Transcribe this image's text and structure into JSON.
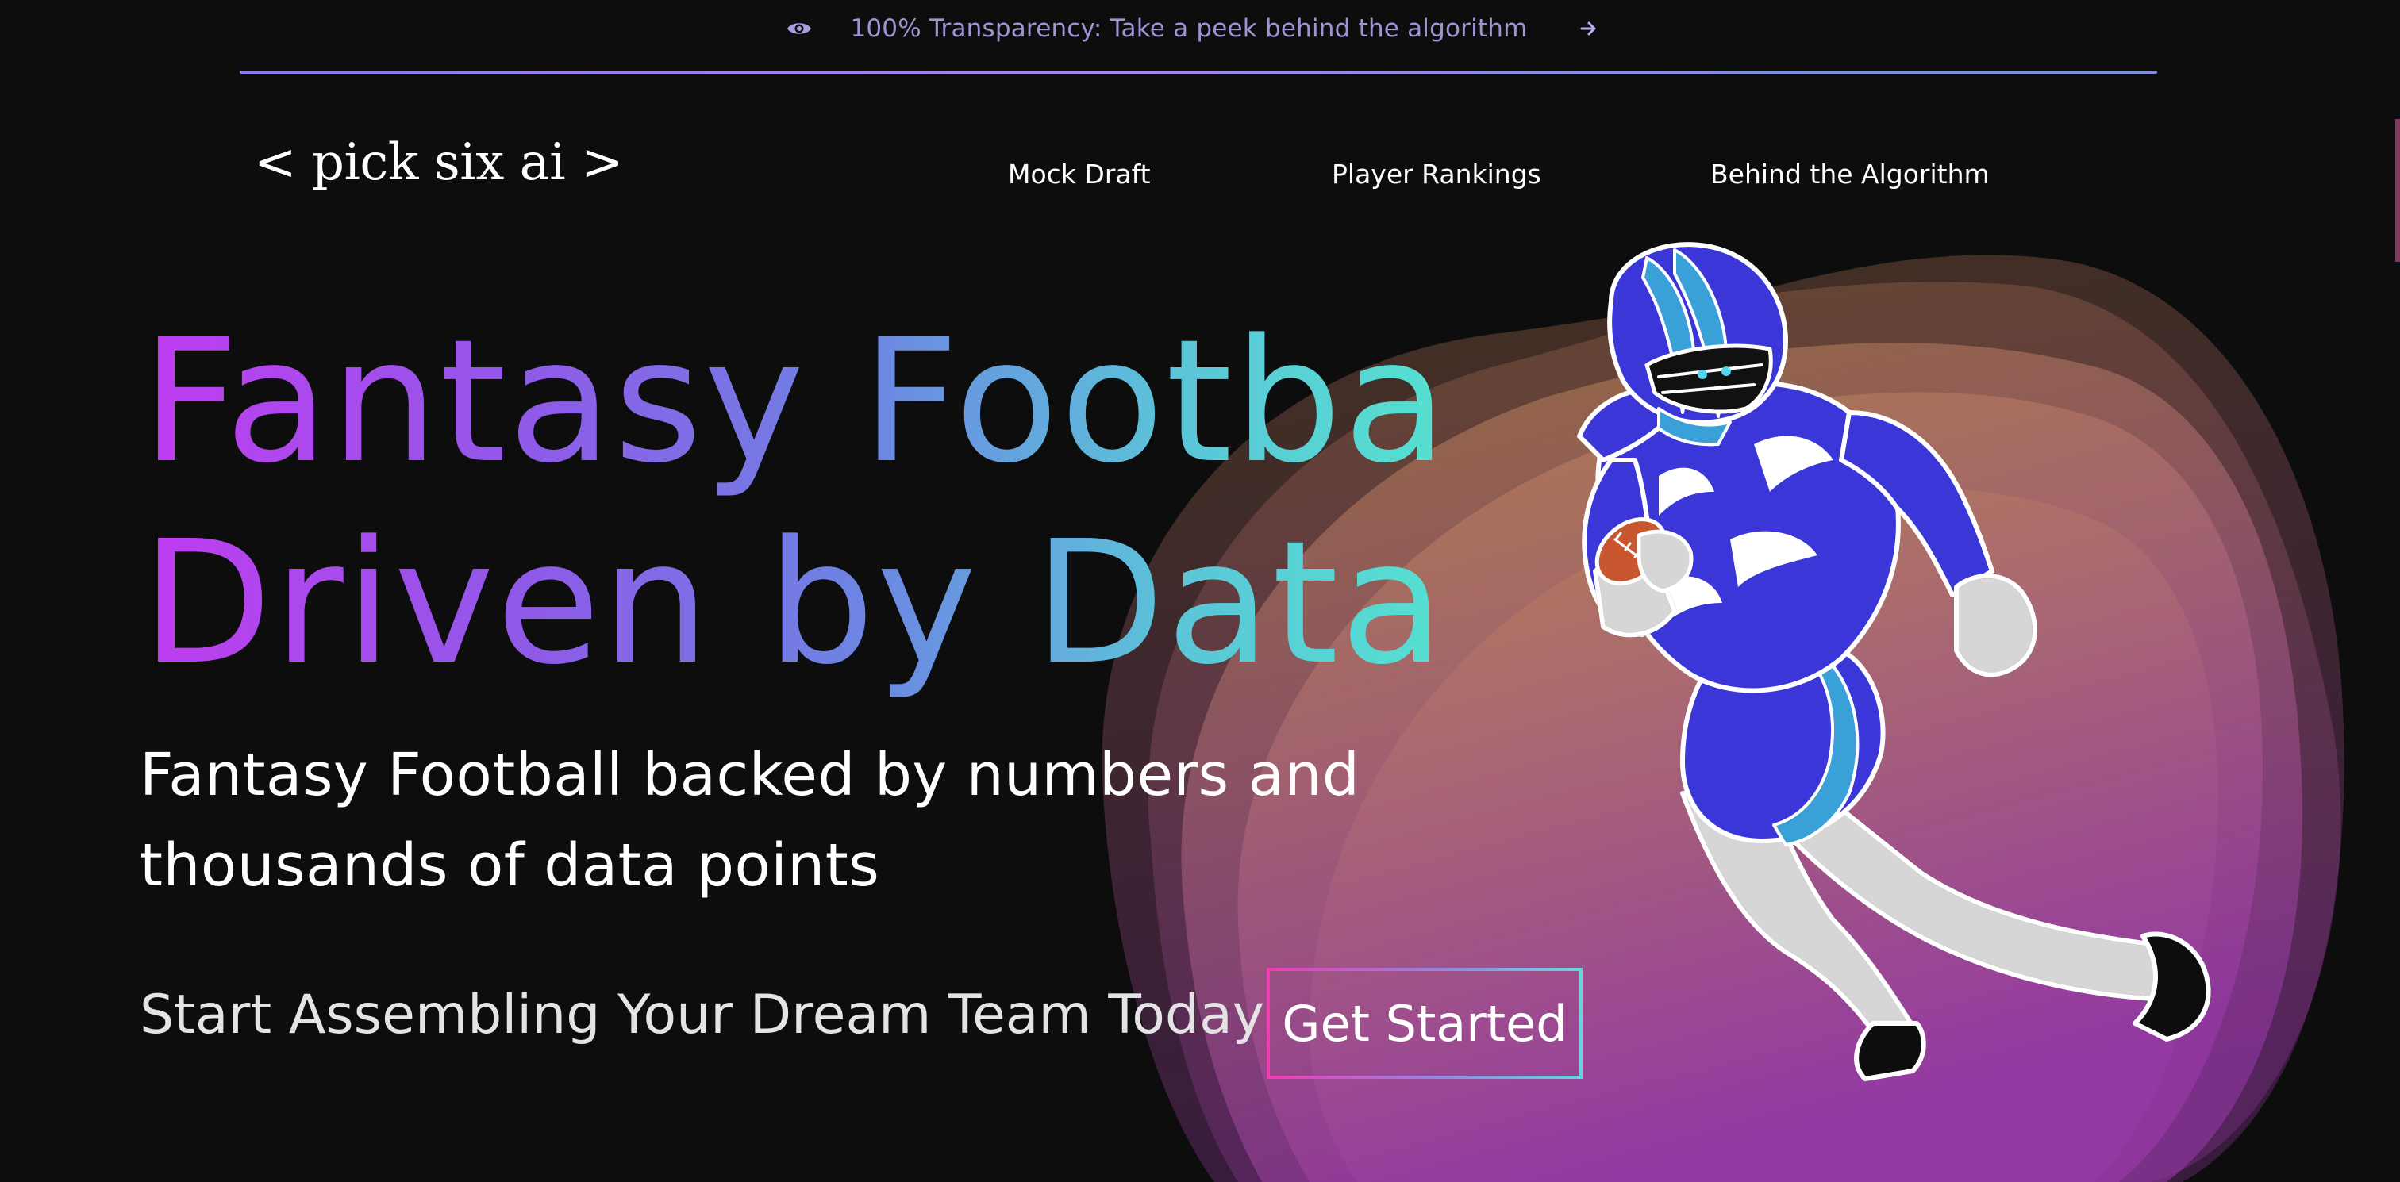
{
  "banner": {
    "icon": "eye-icon",
    "text": "100% Transparency: Take a peek behind the algorithm",
    "arrow_icon": "arrow-right-icon"
  },
  "brand": {
    "logo": "< pick six ai >"
  },
  "nav": {
    "items": [
      {
        "label": "Mock Draft"
      },
      {
        "label": "Player Rankings"
      },
      {
        "label": "Behind the Algorithm"
      }
    ]
  },
  "hero": {
    "headline_line1": "Fantasy Football",
    "headline_line2": "Driven by Data.",
    "sub_line1": "Fantasy Football backed by numbers and",
    "sub_line2": "thousands of data points",
    "cta_text": "Start Assembling Your Dream Team Today",
    "cta_button": "Get Started"
  },
  "colors": {
    "background": "#0d0d0e",
    "banner_text": "#9f93d6",
    "headline_gradient_start": "#c03cf0",
    "headline_gradient_end": "#55e0d0",
    "jersey": "#3b36d8",
    "jersey_stripe": "#3aa0d8",
    "blob_top": "#b9814f",
    "blob_bottom": "#9a3fa8"
  }
}
